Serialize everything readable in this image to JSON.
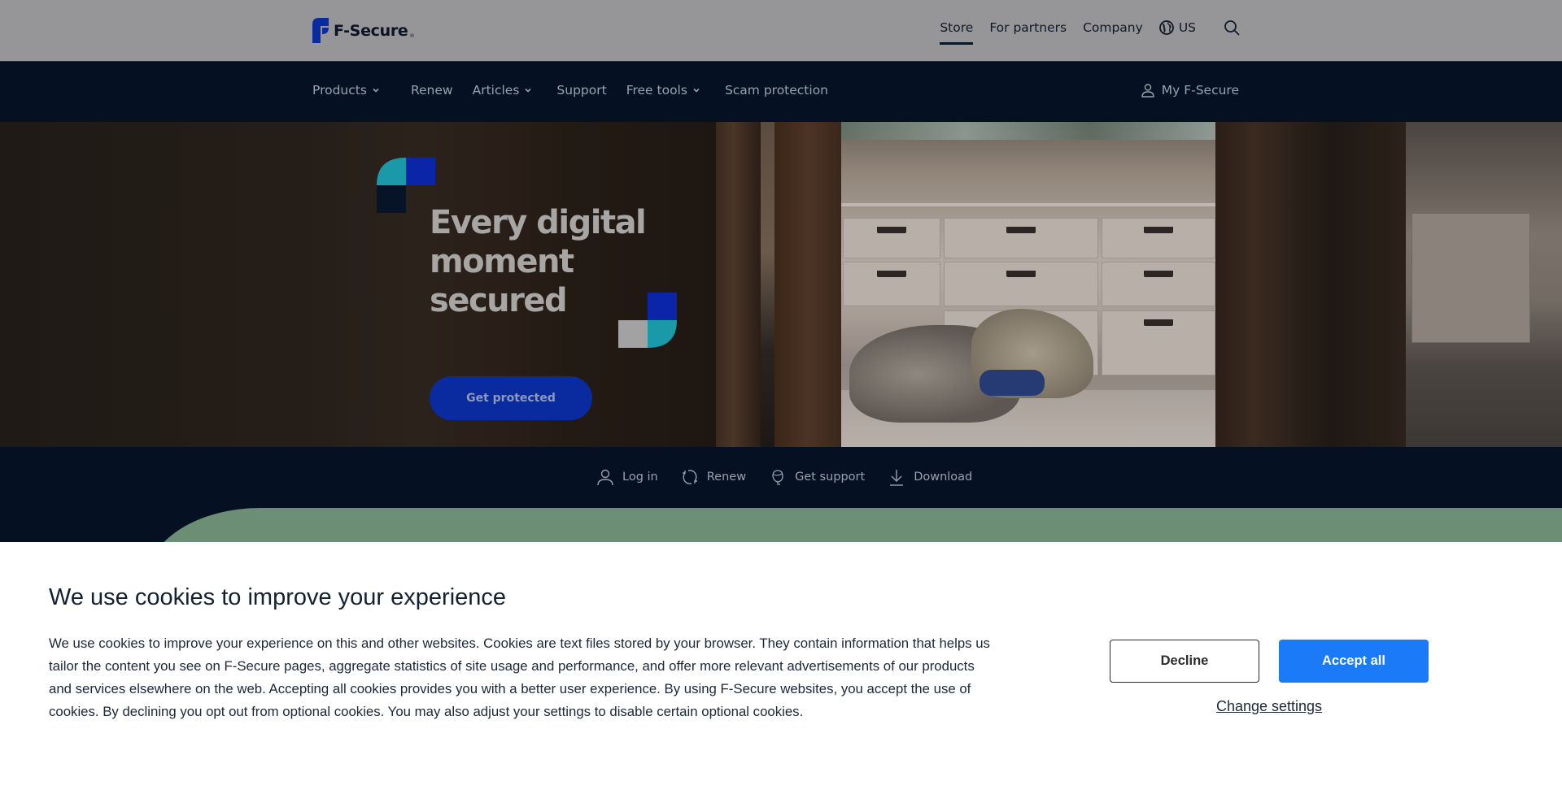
{
  "brand": {
    "name": "F-Secure",
    "registered_mark": "®",
    "colors": {
      "brand_blue": "#0a2aa0",
      "teal": "#1a9aa8",
      "navy": "#051123",
      "green_band": "#6b8e74",
      "accept_blue": "#1a7af8"
    }
  },
  "utility_nav": {
    "items": [
      {
        "label": "Store",
        "active": true
      },
      {
        "label": "For partners",
        "active": false
      },
      {
        "label": "Company",
        "active": false
      }
    ],
    "region": {
      "icon": "globe-icon",
      "label": "US"
    },
    "search_icon": "search-icon"
  },
  "main_nav": {
    "items": [
      {
        "label": "Products",
        "has_dropdown": true
      },
      {
        "label": "Renew",
        "has_dropdown": false
      },
      {
        "label": "Articles",
        "has_dropdown": true
      },
      {
        "label": "Support",
        "has_dropdown": false
      },
      {
        "label": "Free tools",
        "has_dropdown": true
      },
      {
        "label": "Scam protection",
        "has_dropdown": false
      }
    ],
    "account": {
      "icon": "user-icon",
      "label": "My F-Secure"
    }
  },
  "hero": {
    "title_lines": [
      "Every digital",
      "moment",
      "secured"
    ],
    "cta_label": "Get protected"
  },
  "quick_links": [
    {
      "icon": "user-icon",
      "label": "Log in"
    },
    {
      "icon": "refresh-icon",
      "label": "Renew"
    },
    {
      "icon": "support-headset-icon",
      "label": "Get support"
    },
    {
      "icon": "download-icon",
      "label": "Download"
    }
  ],
  "cookie_banner": {
    "title": "We use cookies to improve your experience",
    "body": "We use cookies to improve your experience on this and other websites. Cookies are text files stored by your browser. They contain information that helps us tailor the content you see on F-Secure pages, aggregate statistics of site usage and performance, and offer more relevant advertisements of our products and services elsewhere on the web. Accepting all cookies provides you with a better user experience. By using F-Secure websites, you accept the use of cookies. By declining you opt out from optional cookies. You may also adjust your settings to disable certain optional cookies.",
    "decline_label": "Decline",
    "accept_label": "Accept all",
    "settings_label": "Change settings"
  }
}
